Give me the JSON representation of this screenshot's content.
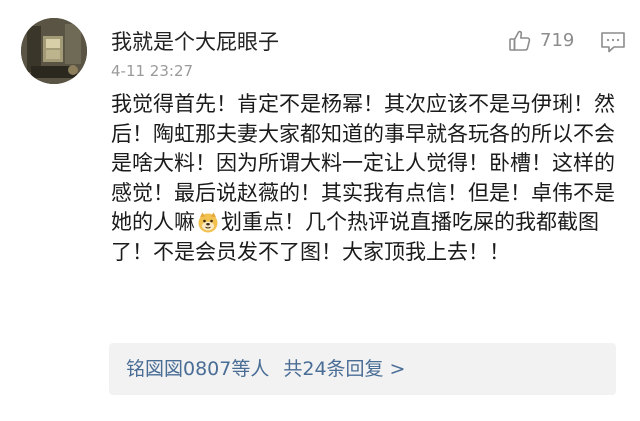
{
  "comment": {
    "author": "我就是个大屁眼子",
    "time": "4-11 23:27",
    "likes": "719",
    "like_icon": "thumbs-up-icon",
    "reply_icon": "comment-bubble-icon",
    "avatar_icon": "user-avatar",
    "text_part1": "我觉得首先！肯定不是杨幂！其次应该不是马伊琍！然后！陶虹那夫妻大家都知道的事早就各玩各的所以不会是啥大料！因为所谓大料一定让人觉得！卧槽！这样的感觉！最后说赵薇的！其实我有点信！但是！卓伟不是她的人嘛",
    "emoji_icon": "doge-emoji-icon",
    "text_part2": "划重点！几个热评说直播吃屎的我都截图了！不是会员发不了图！大家顶我上去！！"
  },
  "replies": {
    "users": "铭図図0807等人",
    "summary": "共24条回复",
    "chevron": ">"
  },
  "colors": {
    "link": "#4a6d96",
    "meta": "#9a9a9a",
    "text": "#1b1b1b",
    "reply_bg": "#f2f2f2"
  }
}
